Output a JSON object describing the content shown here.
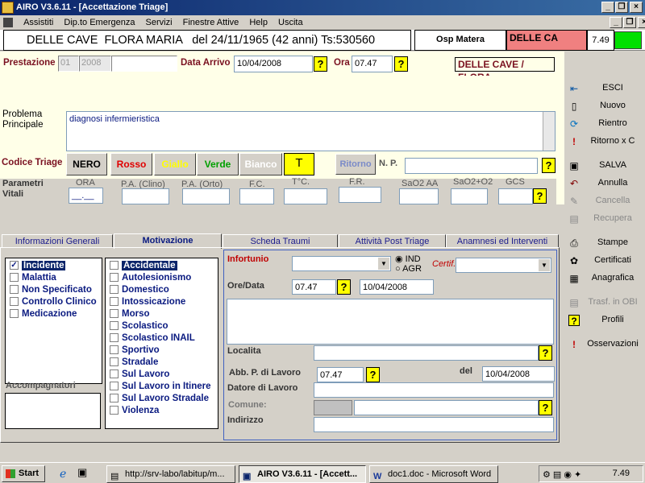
{
  "window": {
    "title": "AIRO V3.6.11 - [Accettazione Triage]"
  },
  "menu": [
    "Assistiti",
    "Dip.to Emergenza",
    "Servizi",
    "Finestre Attive",
    "Help",
    "Uscita"
  ],
  "patient": {
    "header": "DELLE CAVE  FLORA MARIA   del 24/11/1965 (42 anni) Ts:530560",
    "osp": "Osp Matera",
    "short": "DELLE CA",
    "time": "7.49"
  },
  "row2": {
    "prestazione_label": "Prestazione",
    "code1": "01",
    "code2": "2008",
    "data_arrivo_label": "Data Arrivo",
    "data_arrivo": "10/04/2008",
    "ora_label": "Ora",
    "ora": "07.47",
    "name": "DELLE CAVE / FLORA"
  },
  "problema": {
    "label": "Problema Principale",
    "text": "diagnosi infermieristica"
  },
  "triage": {
    "label": "Codice Triage",
    "codes": [
      "NERO",
      "Rosso",
      "Giallo",
      "Verde",
      "Bianco",
      "T"
    ],
    "ritorno": "Ritorno",
    "np_label": "N. P."
  },
  "parametri": {
    "label": "Parametri Vitali",
    "cols": [
      "ORA",
      "P.A. (Clino)",
      "P.A. (Orto)",
      "F.C.",
      "T°C.",
      "F.R.",
      "SaO2 AA",
      "SaO2+O2",
      "GCS"
    ],
    "ora_value": "__.__"
  },
  "tabs": [
    "Informazioni Generali",
    "Motivazione",
    "Scheda Traumi",
    "Attività Post Triage",
    "Anamnesi ed Interventi"
  ],
  "motivazione": {
    "left": [
      {
        "label": "Incidente",
        "checked": true
      },
      {
        "label": "Malattia",
        "checked": false
      },
      {
        "label": "Non Specificato",
        "checked": false
      },
      {
        "label": "Controllo Clinico",
        "checked": false
      },
      {
        "label": "Medicazione",
        "checked": false
      }
    ],
    "right": [
      {
        "label": "Accidentale"
      },
      {
        "label": "Autolesionismo"
      },
      {
        "label": "Domestico"
      },
      {
        "label": "Intossicazione"
      },
      {
        "label": "Morso"
      },
      {
        "label": "Scolastico"
      },
      {
        "label": "Scolastico INAIL"
      },
      {
        "label": "Sportivo"
      },
      {
        "label": "Stradale"
      },
      {
        "label": "Sul Lavoro"
      },
      {
        "label": "Sul Lavoro in Itinere"
      },
      {
        "label": "Sul Lavoro Stradale"
      },
      {
        "label": "Violenza"
      }
    ],
    "accompagnatori": "Accompagnatori"
  },
  "infortunio": {
    "label": "Infortunio",
    "ind": "IND",
    "agr": "AGR",
    "certif": "Certif.",
    "oredata_label": "Ore/Data",
    "ora": "07.47",
    "data": "10/04/2008",
    "localita": "Localita",
    "abb_label": "Abb. P. di Lavoro",
    "abb_ora": "07.47",
    "del_label": "del",
    "del_data": "10/04/2008",
    "datore": "Datore di Lavoro",
    "comune": "Comune:",
    "indirizzo": "Indirizzo"
  },
  "sidebar": [
    "ESCI",
    "Nuovo",
    "Rientro",
    "Ritorno x C",
    "SALVA",
    "Annulla",
    "Cancella",
    "Recupera",
    "Stampe",
    "Certificati",
    "Anagrafica",
    "Trasf. in OBI",
    "Profili",
    "Osservazioni"
  ],
  "taskbar": {
    "start": "Start",
    "items": [
      "http://srv-labo/labitup/m...",
      "AIRO V3.6.11 - [Accett...",
      "doc1.doc - Microsoft Word"
    ],
    "clock": "7.49"
  }
}
